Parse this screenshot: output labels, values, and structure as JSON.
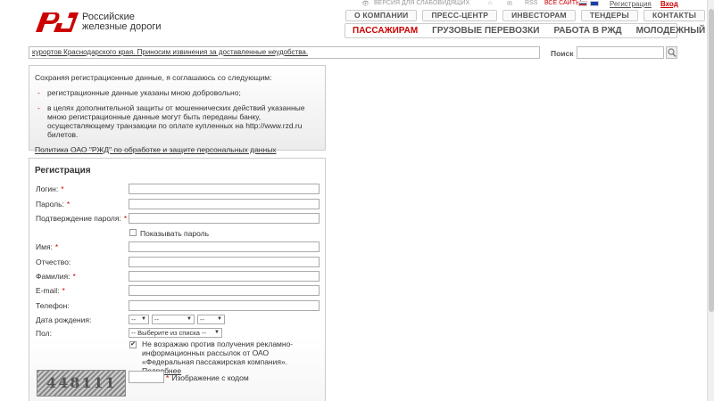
{
  "header": {
    "logo_text_line1": "Российские",
    "logo_text_line2": "железные дороги",
    "util": {
      "version": "ВЕРСИЯ ДЛЯ СЛАБОВИДЯЩИХ",
      "rss": "RSS",
      "all_sites": "ВСЕ САЙТЫ",
      "register": "Регистрация",
      "login": "Вход"
    },
    "nav_top": [
      "О КОМПАНИИ",
      "ПРЕСС-ЦЕНТР",
      "ИНВЕСТОРАМ",
      "ТЕНДЕРЫ",
      "КОНТАКТЫ"
    ],
    "nav_main": [
      "ПАССАЖИРАМ",
      "ГРУЗОВЫЕ ПЕРЕВОЗКИ",
      "РАБОТА В РЖД",
      "МОЛОДЕЖНЫЙ"
    ],
    "nav_main_active": "ПАССАЖИРАМ",
    "colors": {
      "brand_red": "#cc0000"
    }
  },
  "ticker": {
    "text": "курортов Краснодарского края. Приносим извинения за доставленные неудобства."
  },
  "search": {
    "label": "Поиск",
    "value": ""
  },
  "agreement": {
    "intro": "Сохраняя регистрационные данные, я соглашаюсь со следующим:",
    "items": [
      "регистрационные данные указаны мною добровольно;",
      "в целях дополнительной защиты от мошеннических действий указанные мною регистрационные данные могут быть переданы банку, осуществляющему транзакции по оплате купленных на http://www.rzd.ru билетов."
    ],
    "policy_link": "Политика ОАО \"РЖД\" по обработке и защите персональных данных"
  },
  "form": {
    "title": "Регистрация",
    "required_mark": "*",
    "fields": {
      "login": "Логин:",
      "password": "Пароль:",
      "password_confirm": "Подтверждение пароля:",
      "show_password": "Показывать пароль",
      "first_name": "Имя:",
      "middle_name": "Отчество:",
      "last_name": "Фамилия:",
      "email": "E-mail:",
      "phone": "Телефон:",
      "birthdate": "Дата рождения:",
      "gender": "Пол:"
    },
    "birth_day": "--",
    "birth_month": "--",
    "birth_year": "--",
    "gender_value": "-- Выберите из списка --",
    "consent": "Не возражаю против получения рекламно-информационных рассылок от ОАО «Федеральная пассажирская компания».",
    "consent_more": "Подробнее",
    "consent_checked": true,
    "captcha_code": "448111",
    "captcha_label": "Изображение с кодом"
  }
}
